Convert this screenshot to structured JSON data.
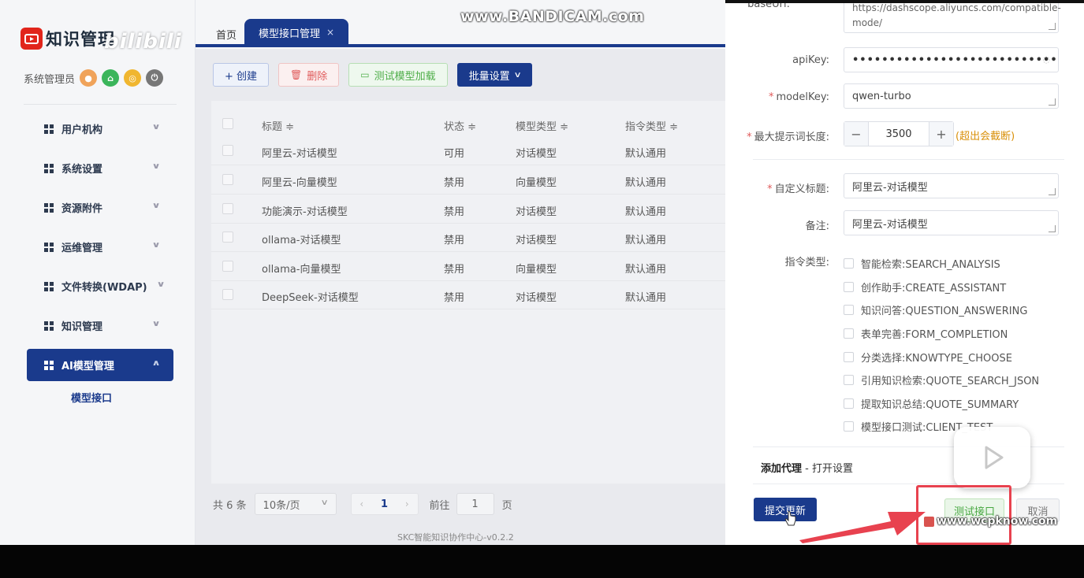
{
  "sidebar": {
    "app_title": "知识管理",
    "overlay_mark": "bilibili",
    "user_name": "系统管理员",
    "user_icons": [
      {
        "name": "avatar-icon",
        "color": "#f0a35a"
      },
      {
        "name": "home-icon",
        "color": "#3bb55b"
      },
      {
        "name": "theme-icon",
        "color": "#f0b630"
      },
      {
        "name": "power-icon",
        "color": "#777777"
      }
    ],
    "menu": [
      {
        "label": "用户机构"
      },
      {
        "label": "系统设置"
      },
      {
        "label": "资源附件"
      },
      {
        "label": "运维管理"
      },
      {
        "label": "文件转换(WDAP)"
      },
      {
        "label": "知识管理"
      },
      {
        "label": "AI模型管理"
      }
    ],
    "submenu": "模型接口"
  },
  "tabs": {
    "home": "首页",
    "active": "模型接口管理",
    "close": "×"
  },
  "recorder_mark": "www.BANDICAM.com",
  "toolbar": {
    "create": "+ 创建",
    "delete": "删除",
    "test_load": "测试模型加载",
    "batch": "批量设置"
  },
  "table": {
    "headers": {
      "title": "标题 ≑",
      "status": "状态 ≑",
      "model_type": "模型类型 ≑",
      "instruction_type": "指令类型 ≑"
    },
    "rows": [
      {
        "title": "阿里云-对话模型",
        "status": "可用",
        "model_type": "对话模型",
        "instruction_type": "默认通用"
      },
      {
        "title": "阿里云-向量模型",
        "status": "禁用",
        "model_type": "向量模型",
        "instruction_type": "默认通用"
      },
      {
        "title": "功能演示-对话模型",
        "status": "禁用",
        "model_type": "对话模型",
        "instruction_type": "默认通用"
      },
      {
        "title": "ollama-对话模型",
        "status": "禁用",
        "model_type": "对话模型",
        "instruction_type": "默认通用"
      },
      {
        "title": "ollama-向量模型",
        "status": "禁用",
        "model_type": "向量模型",
        "instruction_type": "默认通用"
      },
      {
        "title": "DeepSeek-对话模型",
        "status": "禁用",
        "model_type": "对话模型",
        "instruction_type": "默认通用"
      }
    ]
  },
  "pager": {
    "total": "共 6 条",
    "page_size": "10条/页",
    "prev": "‹",
    "current": "1",
    "next": "›",
    "goto": "前往",
    "goto_value": "1",
    "page_word": "页"
  },
  "footer": "SKC智能知识协作中心-v0.2.2",
  "form": {
    "base_url_label": "baseUrl:",
    "base_url_line1": "https://dashscope.aliyuncs.com/compatible-",
    "base_url_line2": "mode/",
    "api_key_label": "apiKey:",
    "api_key_value": "••••••••••••••••••••••••••••",
    "model_key_label": "modelKey:",
    "model_key_value": "qwen-turbo",
    "max_prompt_label": "最大提示词长度:",
    "max_prompt_value": "3500",
    "max_prompt_hint": "(超出会截断)",
    "title_label": "自定义标题:",
    "title_value": "阿里云-对话模型",
    "remark_label": "备注:",
    "remark_value": "阿里云-对话模型",
    "instruction_label": "指令类型:",
    "instruction_options": [
      "智能检索:SEARCH_ANALYSIS",
      "创作助手:CREATE_ASSISTANT",
      "知识问答:QUESTION_ANSWERING",
      "表单完善:FORM_COMPLETION",
      "分类选择:KNOWTYPE_CHOOSE",
      "引用知识检索:QUOTE_SEARCH_JSON",
      "提取知识总结:QUOTE_SUMMARY",
      "模型接口测试:CLIENT_TEST"
    ],
    "proxy_title": "添加代理",
    "proxy_action": " - 打开设置",
    "submit": "提交更新",
    "test": "测试接口",
    "cancel": "取消"
  },
  "site_mark": "www.wcpknow.com",
  "colors": {
    "primary": "#1a3a8c",
    "danger": "#e05a5a",
    "success": "#4fae49",
    "warning": "#d9900a",
    "annotation_red": "#e8424f"
  }
}
